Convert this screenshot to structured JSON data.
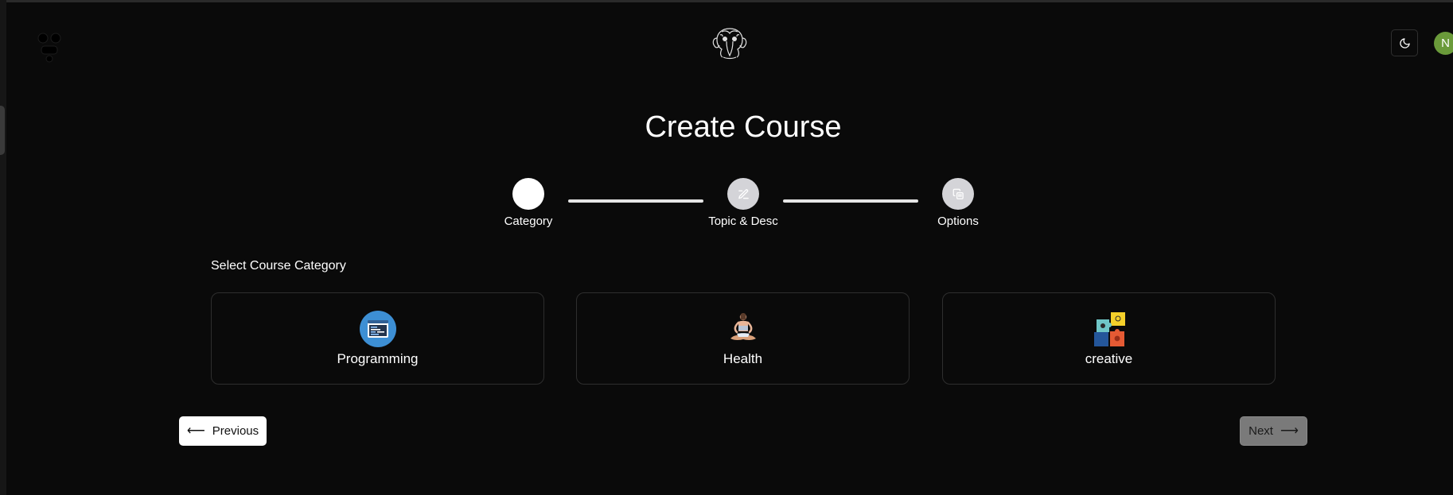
{
  "header": {
    "avatar_initial": "N",
    "theme_toggle_icon": "moon-icon",
    "logo_icon": "elephant-logo-icon"
  },
  "page": {
    "title": "Create Course"
  },
  "stepper": {
    "steps": [
      {
        "label": "Category",
        "icon": "grid-icon",
        "state": "active"
      },
      {
        "label": "Topic & Desc",
        "icon": "pencil-icon",
        "state": "inactive"
      },
      {
        "label": "Options",
        "icon": "copy-icon",
        "state": "inactive"
      }
    ]
  },
  "category_section": {
    "label": "Select Course Category",
    "cards": [
      {
        "label": "Programming",
        "icon": "code-window-icon"
      },
      {
        "label": "Health",
        "icon": "meditation-icon"
      },
      {
        "label": "creative",
        "icon": "puzzle-icon"
      }
    ]
  },
  "navigation": {
    "previous_label": "Previous",
    "next_label": "Next"
  },
  "colors": {
    "background": "#0a0a0a",
    "avatar": "#6a9a3a",
    "next_disabled": "#7a7a7a",
    "step_active": "#ffffff",
    "step_inactive": "#d4d4d8"
  }
}
